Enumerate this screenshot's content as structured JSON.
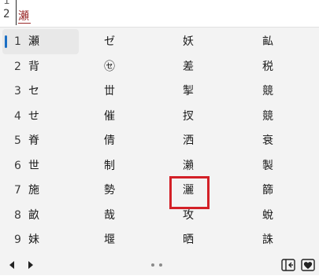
{
  "editor": {
    "line_numbers": [
      "1",
      "2"
    ],
    "composing_text": "瀬"
  },
  "candidates": {
    "selected_index": 0,
    "rows": [
      {
        "num": "1",
        "items": [
          "瀬",
          "ゼ",
          "妖",
          "畆"
        ]
      },
      {
        "num": "2",
        "items": [
          "背",
          "㋝",
          "差",
          "税"
        ]
      },
      {
        "num": "3",
        "items": [
          "セ",
          "丗",
          "掣",
          "競"
        ]
      },
      {
        "num": "4",
        "items": [
          "せ",
          "催",
          "扠",
          "競"
        ]
      },
      {
        "num": "5",
        "items": [
          "脊",
          "倩",
          "洒",
          "衰"
        ]
      },
      {
        "num": "6",
        "items": [
          "世",
          "制",
          "瀨",
          "製"
        ]
      },
      {
        "num": "7",
        "items": [
          "施",
          "勢",
          "灑",
          "篩"
        ]
      },
      {
        "num": "8",
        "items": [
          "畝",
          "哉",
          "攻",
          "蛻"
        ]
      },
      {
        "num": "9",
        "items": [
          "妹",
          "堰",
          "晒",
          "誅"
        ]
      }
    ]
  },
  "toolbar": {
    "prev_icon": "triangle-left-icon",
    "next_icon": "triangle-right-icon",
    "page_indicator_dots": 2,
    "panel_toggle_icon": "panel-collapse-icon",
    "favorites_icon": "heart-box-icon"
  },
  "colors": {
    "selection_accent": "#1b6fc4",
    "highlight_box": "#d32027",
    "composition_text": "#9b2b2b"
  }
}
